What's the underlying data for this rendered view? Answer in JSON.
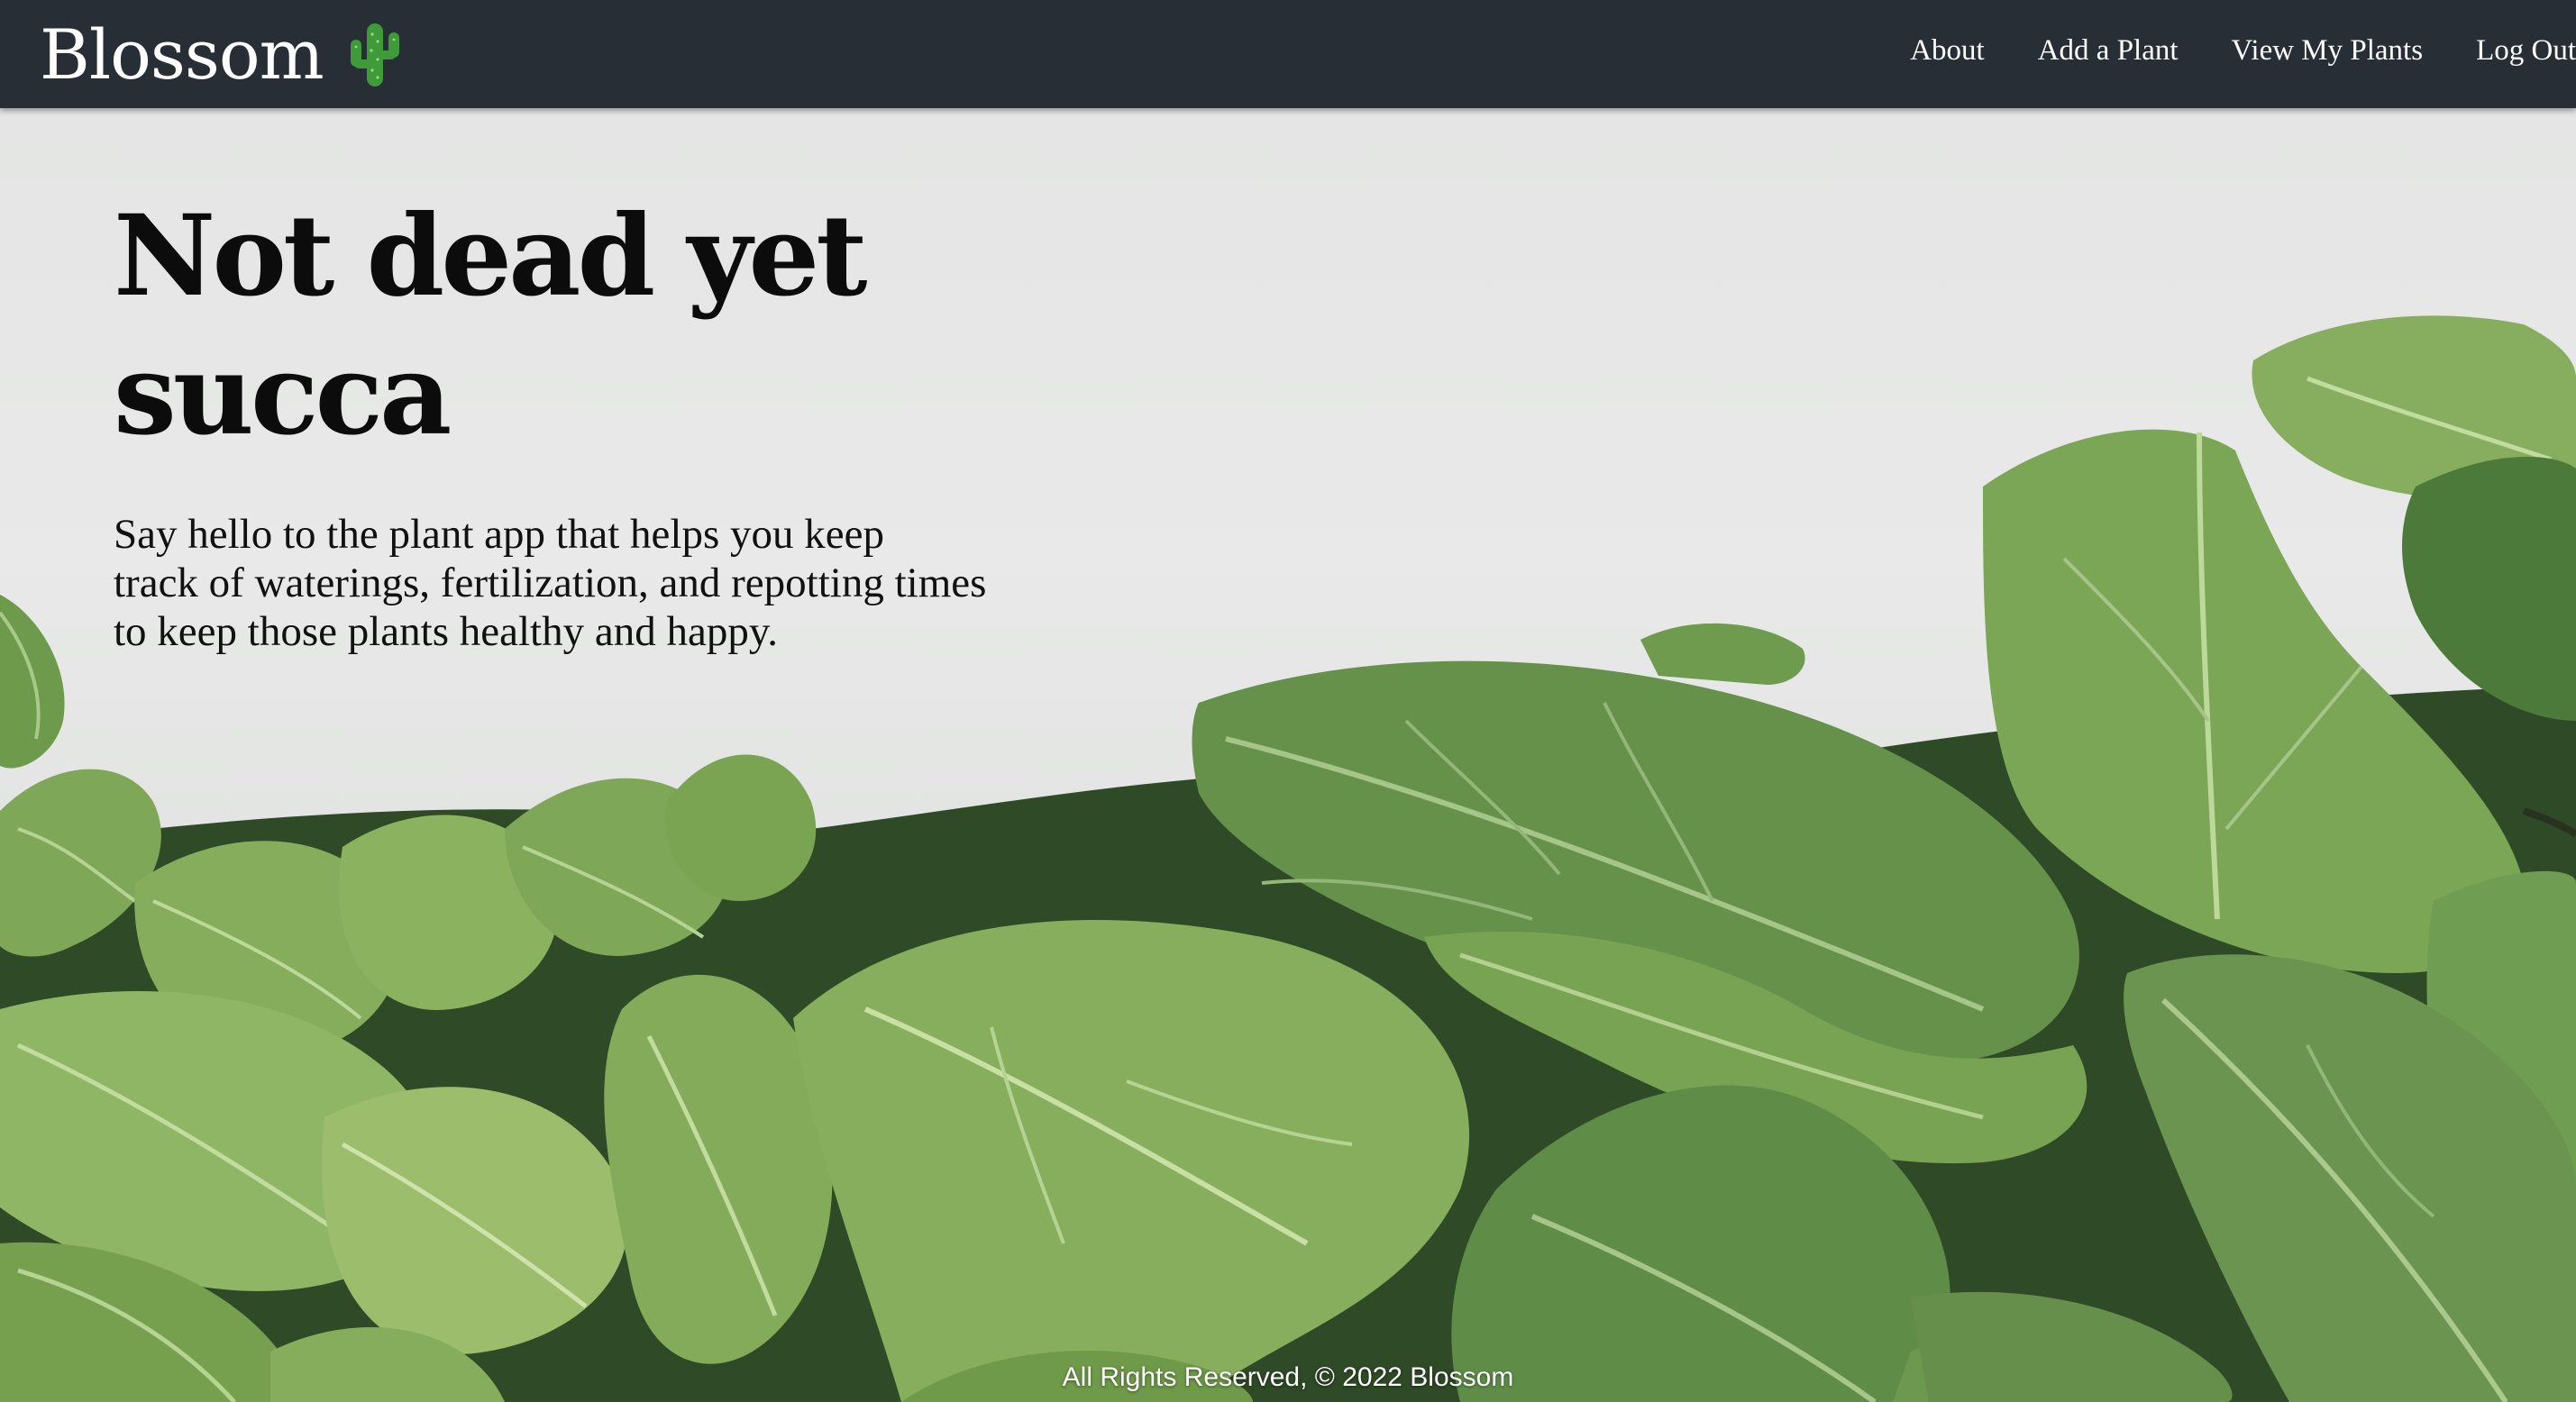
{
  "navbar": {
    "brand": "Blossom",
    "brand_icon": "cactus-icon",
    "background_color": "#282e36",
    "links": [
      {
        "label": "About"
      },
      {
        "label": "Add a Plant"
      },
      {
        "label": "View My Plants"
      },
      {
        "label": "Log Out"
      }
    ]
  },
  "hero": {
    "title_line1": "Not dead yet",
    "title_line2": "succa",
    "subtitle_line1": "Say hello to the plant app that helps you keep",
    "subtitle_line2": "track of waterings, fertilization, and repotting times",
    "subtitle_line3": "to keep those plants healthy and happy.",
    "background_image": "elephant-ear-plant-leaves"
  },
  "footer": {
    "text": "All Rights Reserved, © 2022 Blossom"
  },
  "colors": {
    "nav_background": "#282e36",
    "wall": "#e6e7e6",
    "leaf_green": "#6f9a4b",
    "leaf_dark": "#3f6a34"
  }
}
